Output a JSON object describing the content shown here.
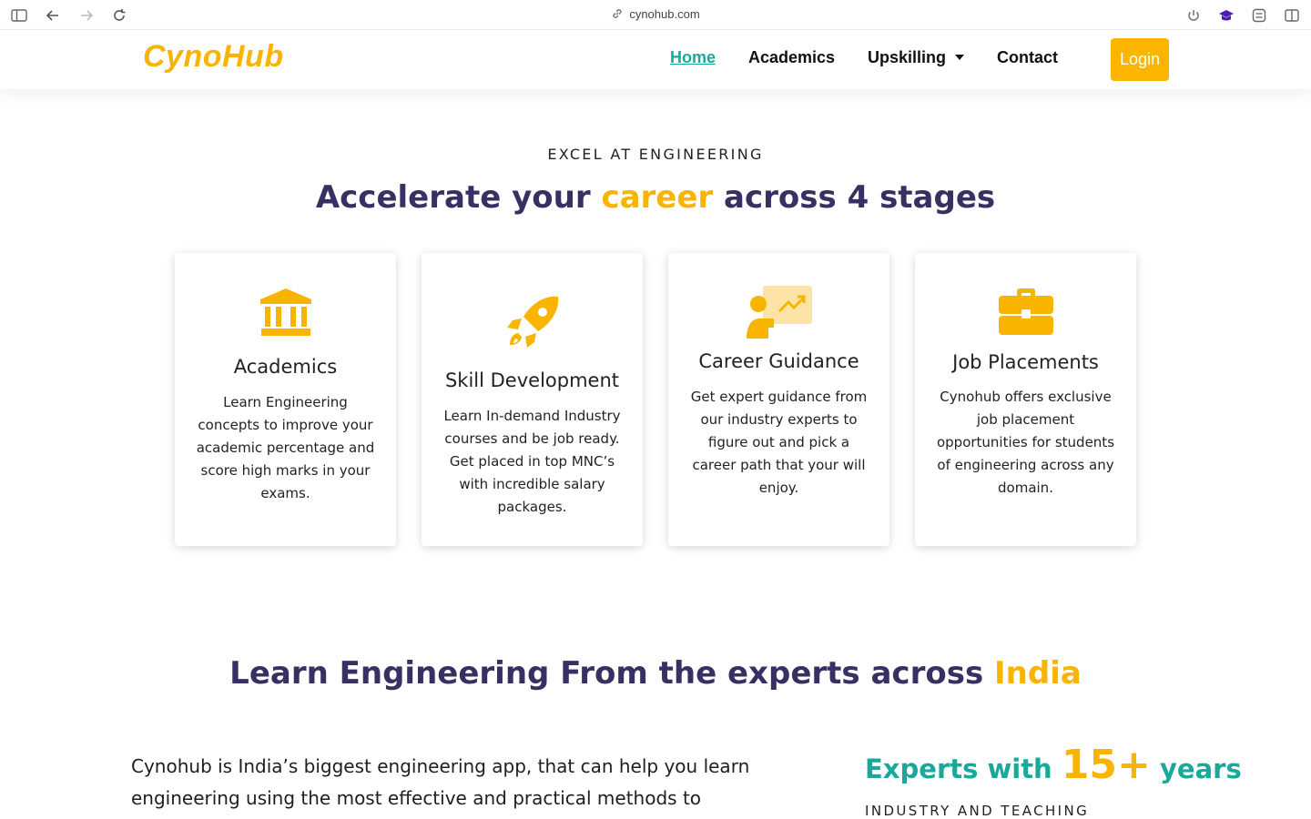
{
  "browser": {
    "url": "cynohub.com"
  },
  "navbar": {
    "brand": "CynoHub",
    "links": [
      "Home",
      "Academics",
      "Upskilling",
      "Contact"
    ],
    "login_label": "Login"
  },
  "hero": {
    "eyebrow": "EXCEL AT ENGINEERING",
    "title_before": "Accelerate your ",
    "title_accent": "career",
    "title_after": " across 4 stages"
  },
  "cards": [
    {
      "icon": "bank-icon",
      "title": "Academics",
      "text": "Learn Engineering concepts to improve your academic percentage and score high marks in your exams."
    },
    {
      "icon": "rocket-icon",
      "title": "Skill Development",
      "text": "Learn In-demand Industry courses and be job ready. Get placed in top MNC’s with incredible salary packages."
    },
    {
      "icon": "presentation-icon",
      "title": "Career Guidance",
      "text": "Get expert guidance from our industry experts to figure out and pick a career path that your will enjoy."
    },
    {
      "icon": "briefcase-icon",
      "title": "Job Placements",
      "text": "Cynohub offers exclusive job placement opportunities for students of engineering across any domain."
    }
  ],
  "learn": {
    "title_before": "Learn Engineering From the experts across ",
    "title_accent": "India",
    "intro": "Cynohub is India’s biggest engineering app, that can help you learn engineering using the most effective and practical methods to transform",
    "experts_before": "Experts with ",
    "experts_number": "15+",
    "experts_after": " years",
    "industry": "INDUSTRY AND TEACHING"
  },
  "colors": {
    "accent": "#f9b400",
    "teal": "#19a99a",
    "heading": "#3a2f63"
  }
}
